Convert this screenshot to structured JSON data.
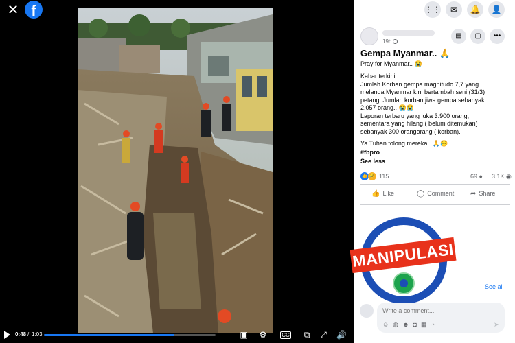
{
  "viewer": {
    "close_icon": "close-icon",
    "logo_text": "f",
    "controls": {
      "current_time": "0:48",
      "separator": "/",
      "total_time": "1:03",
      "progress_fraction": 0.76
    }
  },
  "topbar": {
    "icons": [
      "menu-grid-icon",
      "messenger-icon",
      "bell-icon",
      "profile-icon"
    ]
  },
  "post": {
    "time": "19h",
    "title": "Gempa Myanmar.. 🙏",
    "subtitle": "Pray for Myanmar.. 😭",
    "body_lines": [
      "Kabar terkini :",
      "Jumlah Korban gempa magnitudo 7,7 yang",
      "melanda Myanmar kini bertambah seni (31/3)",
      "petang. Jumlah korban jiwa gempa sebanyak",
      "2.057 orang.. 😭😭",
      "Laporan terbaru yang luka 3.900 orang,",
      "sementara yang hilang ( belum ditemukan)",
      "sebanyak 300 orangorang ( korban)."
    ],
    "closing_line": "Ya Tuhan tolong mereka.. 🙏😥",
    "hashtag": "#fbpro",
    "see_less": "See less",
    "reaction_count": "115",
    "comment_count": "69",
    "view_count": "3.1K",
    "actions": {
      "like": "Like",
      "comment": "Comment",
      "share": "Share"
    }
  },
  "stamp": {
    "label": "MANIPULASI"
  },
  "comments": {
    "see_all": "See all",
    "placeholder": "Write a comment..."
  },
  "colors": {
    "facebook_blue": "#1877f2",
    "stamp_red": "#e8321b",
    "stamp_blue": "#1c4eb5"
  }
}
